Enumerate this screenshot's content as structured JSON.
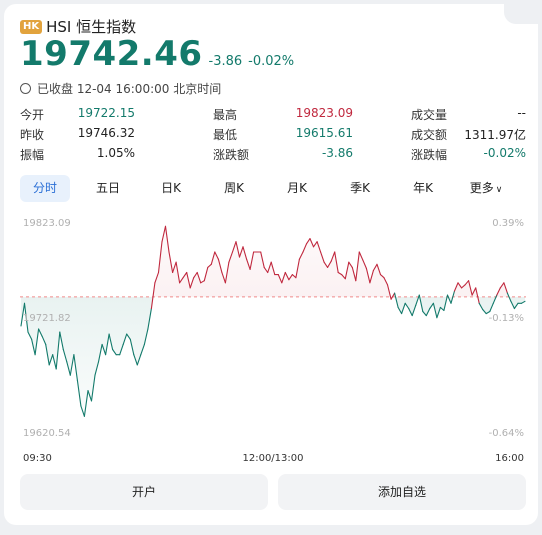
{
  "header": {
    "badge": "HK",
    "title": "HSI 恒生指数"
  },
  "quote": {
    "price": "19742.46",
    "change": "-3.86",
    "change_pct": "-0.02%"
  },
  "status": "已收盘 12-04 16:00:00 北京时间",
  "stats": [
    [
      {
        "label": "今开",
        "value": "19722.15"
      },
      {
        "label": "最高",
        "value": "19823.09"
      },
      {
        "label": "成交量",
        "value": "--"
      }
    ],
    [
      {
        "label": "昨收",
        "value": "19746.32"
      },
      {
        "label": "最低",
        "value": "19615.61"
      },
      {
        "label": "成交额",
        "value": "1311.97亿"
      }
    ],
    [
      {
        "label": "振幅",
        "value": "1.05%"
      },
      {
        "label": "涨跌额",
        "value": "-3.86"
      },
      {
        "label": "涨跌幅",
        "value": "-0.02%"
      }
    ]
  ],
  "tabs": [
    "分时",
    "五日",
    "日K",
    "周K",
    "月K",
    "季K",
    "年K",
    "更多"
  ],
  "buttons": {
    "open_account": "开户",
    "add_watchlist": "添加自选"
  },
  "colors": {
    "up": "#c0283e",
    "down": "#137a6b",
    "accent": "#2a6fd6",
    "badge": "#e2a33d"
  },
  "chart_data": {
    "type": "line",
    "y_left_ticks": [
      "19823.09",
      "19721.82",
      "19620.54"
    ],
    "y_right_ticks": [
      "0.39%",
      "-0.13%",
      "-0.64%"
    ],
    "x_ticks": [
      "09:30",
      "12:00/13:00",
      "16:00"
    ],
    "prev_close": 19746.32,
    "ylim": [
      19620.54,
      19823.09
    ],
    "series": [
      {
        "values": [
          19718,
          19740,
          19712,
          19705,
          19690,
          19715,
          19708,
          19700,
          19680,
          19690,
          19676,
          19712,
          19695,
          19683,
          19670,
          19690,
          19665,
          19640,
          19630,
          19655,
          19645,
          19670,
          19683,
          19700,
          19690,
          19710,
          19695,
          19690,
          19690,
          19700,
          19710,
          19705,
          19690,
          19680,
          19690,
          19700,
          19715,
          19735,
          19760,
          19770,
          19800,
          19815,
          19790,
          19770,
          19780,
          19760,
          19765,
          19770,
          19755,
          19765,
          19770,
          19760,
          19762,
          19775,
          19778,
          19790,
          19783,
          19770,
          19760,
          19780,
          19790,
          19800,
          19785,
          19795,
          19783,
          19773,
          19790,
          19790,
          19790,
          19775,
          19770,
          19780,
          19768,
          19768,
          19760,
          19770,
          19763,
          19768,
          19765,
          19783,
          19790,
          19798,
          19803,
          19795,
          19800,
          19790,
          19780,
          19775,
          19781,
          19790,
          19770,
          19768,
          19764,
          19780,
          19775,
          19762,
          19790,
          19782,
          19774,
          19760,
          19772,
          19778,
          19768,
          19765,
          19758,
          19744,
          19750,
          19736,
          19730,
          19740,
          19735,
          19728,
          19738,
          19748,
          19732,
          19728,
          19735,
          19740,
          19726,
          19736,
          19733,
          19748,
          19740,
          19752,
          19760,
          19755,
          19758,
          19762,
          19748,
          19755,
          19740,
          19734,
          19730,
          19732,
          19740,
          19748,
          19755,
          19760,
          19750,
          19742,
          19735,
          19740,
          19740,
          19742
        ]
      }
    ]
  }
}
